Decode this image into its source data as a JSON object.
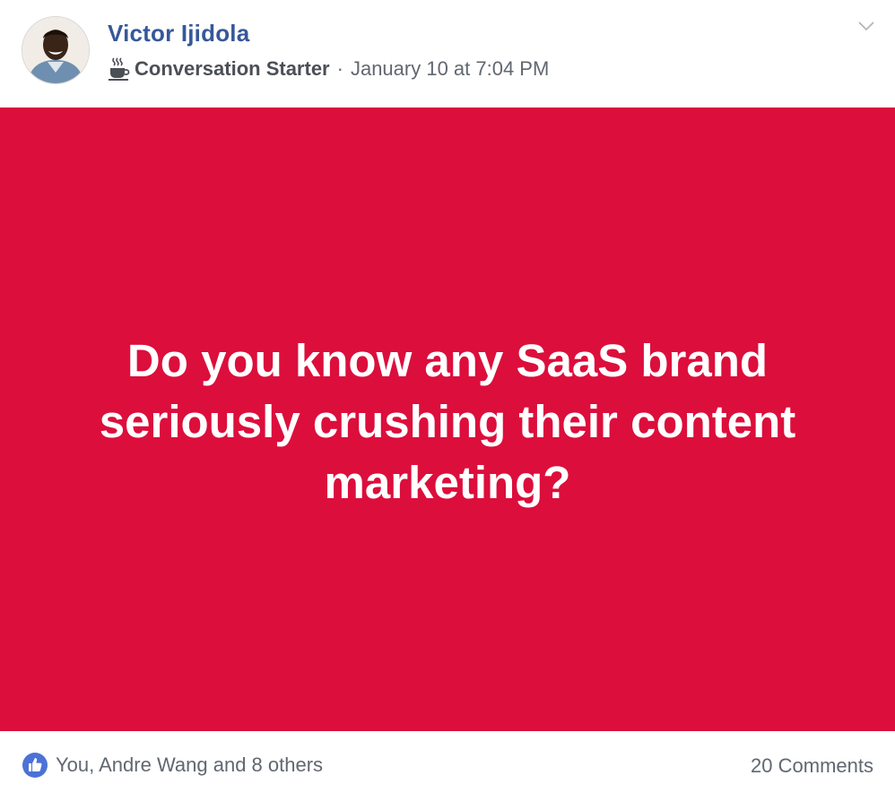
{
  "post": {
    "author": "Victor Ijidola",
    "badge_icon": "coffee-cup-icon",
    "badge_label": "Conversation Starter",
    "separator": "·",
    "timestamp": "January 10 at 7:04 PM",
    "menu_icon": "chevron-down-icon",
    "body_text": "Do you know any SaaS brand seriously crushing their content marketing?",
    "background_color": "#dc0e3c",
    "text_color": "#ffffff"
  },
  "footer": {
    "like_icon": "thumbs-up-icon",
    "likes_text": "You, Andre Wang and 8 others",
    "comments_text": "20 Comments"
  },
  "colors": {
    "author_name": "#365899",
    "meta_text": "#616770",
    "like_blue": "#4c72d6"
  }
}
